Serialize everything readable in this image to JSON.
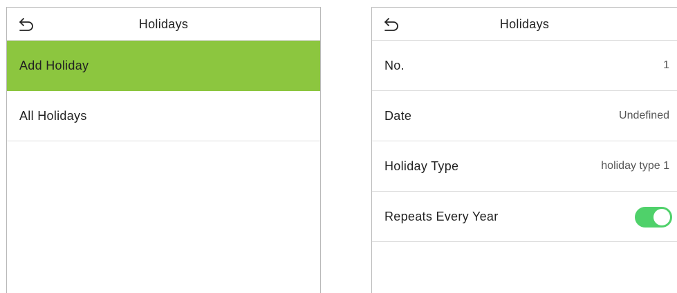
{
  "left_screen": {
    "title": "Holidays",
    "menu": [
      {
        "label": "Add Holiday",
        "selected": true
      },
      {
        "label": "All Holidays",
        "selected": false
      }
    ]
  },
  "right_screen": {
    "title": "Holidays",
    "fields": [
      {
        "label": "No.",
        "value": "1"
      },
      {
        "label": "Date",
        "value": "Undefined"
      },
      {
        "label": "Holiday Type",
        "value": "holiday type 1"
      },
      {
        "label": "Repeats Every Year",
        "toggle_on": true
      }
    ]
  },
  "colors": {
    "selected_row": "#8cc63f",
    "toggle_on": "#4fd16a",
    "divider": "#dcdcdc"
  },
  "icons": {
    "back": "back-arrow-icon"
  }
}
